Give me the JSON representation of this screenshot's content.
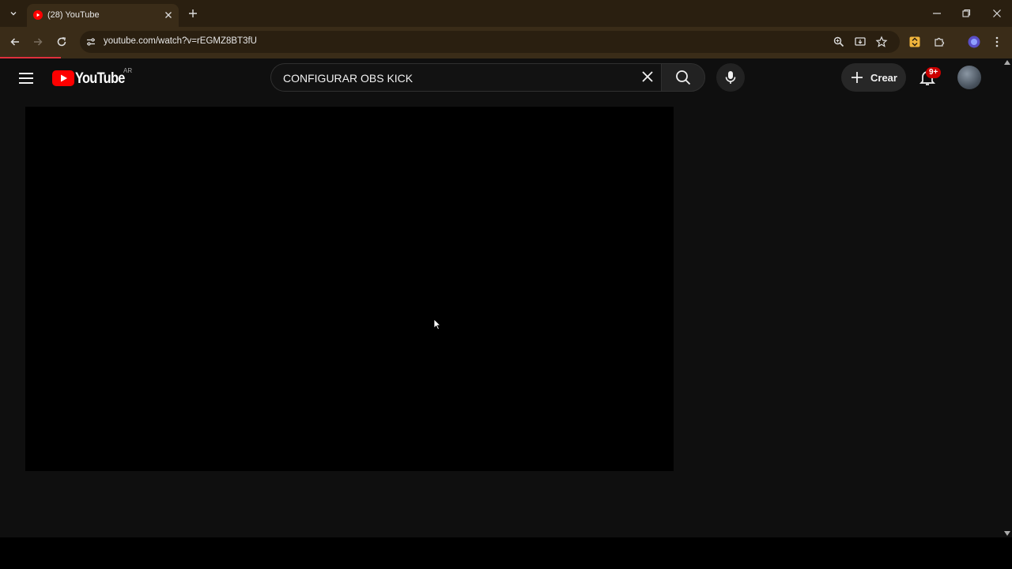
{
  "browser": {
    "tab": {
      "title": "(28) YouTube"
    },
    "address_bar": {
      "url": "youtube.com/watch?v=rEGMZ8BT3fU"
    },
    "load_progress_pct": 6
  },
  "youtube": {
    "logo": {
      "text": "YouTube",
      "country_code": "AR"
    },
    "search": {
      "value": "CONFIGURAR OBS KICK"
    },
    "create_button": {
      "label": "Crear"
    },
    "notifications": {
      "badge": "9+"
    }
  },
  "colors": {
    "brand_red": "#ff0000",
    "badge_red": "#cc0000",
    "chrome_bg": "#3a2c18",
    "page_bg": "#0f0f0f"
  }
}
